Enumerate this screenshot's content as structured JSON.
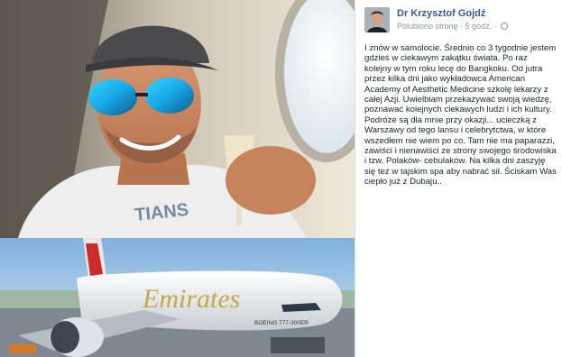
{
  "post": {
    "author": "Dr Krzysztof Gojdź",
    "meta_text": "Polubiono stronę · 5 godz. ·",
    "body": "I znów w samolocie. Średnio co 3 tygodnie jestem gdzieś w ciekawym zakątku świata. Po raz kolejny w tym roku lecę do Bangkoku. Od jutra przez kilka dni jako wykładowca American Academy of Aesthetic Medicine szkolę lekarzy z całej Azji. Uwielbiam przekazywać swoją wiedzę, poznawać kolejnych ciekawych ludzi i ich kultury. Podróże są dla mnie przy okazji... ucieczką z Warszawy od tego lansu i celebrytctwa, w które wszedłem nie wiem po co. Tam nie ma paparazzi, zawiści i nienawiści ze strony swojego środowiska i tzw. Polaków- cebulaków. Na kilka dni zaszyję się też w tajskim spa aby nabrać sił. Ściskam Was ciepło już z Dubaju..",
    "photos": [
      {
        "kind": "selfie-photo"
      },
      {
        "kind": "airplane-photo",
        "livery_text": "Emirates",
        "reg_text": "BOEING 777-300ER"
      }
    ]
  },
  "colors": {
    "author_link": "#365899",
    "meta": "#90949c",
    "text": "#1d2129",
    "border": "#dddfe2"
  }
}
